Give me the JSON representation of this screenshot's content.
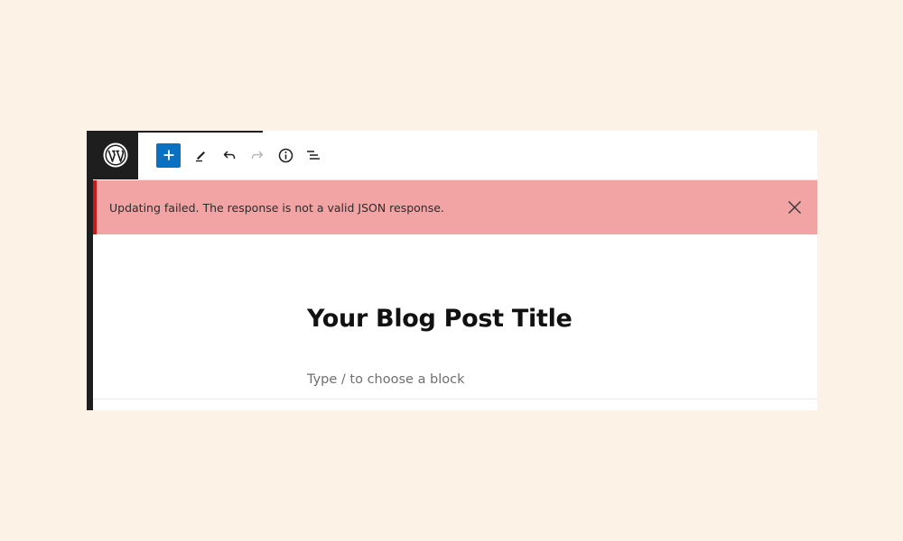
{
  "toolbar": {
    "logo_icon": "wordpress-logo-icon",
    "add_icon": "plus-icon",
    "tools_icon": "pencil-icon",
    "undo_icon": "undo-icon",
    "redo_icon": "redo-icon",
    "details_icon": "info-icon",
    "outline_icon": "list-view-icon"
  },
  "notice": {
    "message": "Updating failed. The response is not a valid JSON response.",
    "close_icon": "close-icon",
    "background_color": "#f2a3a3",
    "border_color": "#cc1818"
  },
  "editor": {
    "post_title": "Your Blog Post Title",
    "block_placeholder": "Type / to choose a block"
  },
  "colors": {
    "page_background": "#fdf2e6",
    "accent": "#0a70c2",
    "dark": "#1e1e1e"
  }
}
